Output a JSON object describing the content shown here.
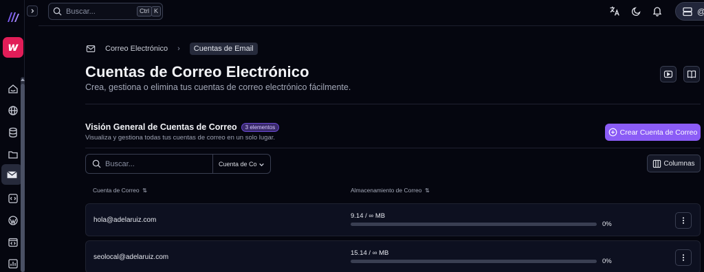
{
  "colors": {
    "accent": "#8b5cf6",
    "brand": "#e11d58",
    "background": "#05060f"
  },
  "sidebar": {
    "brand_icon": "brand-logo-icon",
    "app_icon_label": "w",
    "items": [
      {
        "icon": "home-icon"
      },
      {
        "icon": "globe-icon"
      },
      {
        "icon": "database-icon"
      },
      {
        "icon": "folder-icon"
      },
      {
        "icon": "mail-icon",
        "active": true
      },
      {
        "icon": "code-icon"
      },
      {
        "icon": "wordpress-icon"
      },
      {
        "icon": "browser-code-icon"
      },
      {
        "icon": "chart-icon"
      }
    ]
  },
  "topbar": {
    "search_placeholder": "Buscar...",
    "shortcut_keys": [
      "Ctrl",
      "K"
    ],
    "user_initial": "@"
  },
  "breadcrumb": {
    "parent": "Correo Electrónico",
    "current": "Cuentas de Email"
  },
  "page": {
    "title": "Cuentas de Correo Electrónico",
    "subtitle": "Crea, gestiona o elimina tus cuentas de correo electrónico fácilmente."
  },
  "section": {
    "title": "Visión General de Cuentas de Correo",
    "badge": "3 elementos",
    "subtitle": "Visualiza y gestiona todas tus cuentas de correo en un solo lugar.",
    "create_button": "Crear Cuenta de Correo"
  },
  "filters": {
    "search_placeholder": "Buscar...",
    "select_value": "Cuenta de Co",
    "columns_button": "Columnas"
  },
  "table": {
    "headers": [
      "Cuenta de Correo",
      "Almacenamiento de Correo"
    ],
    "rows": [
      {
        "email": "hola@adelaruiz.com",
        "usage": "9.14 / ∞ MB",
        "percent_label": "0%",
        "percent": 0
      },
      {
        "email": "seolocal@adelaruiz.com",
        "usage": "15.14 / ∞ MB",
        "percent_label": "0%",
        "percent": 0
      }
    ]
  }
}
